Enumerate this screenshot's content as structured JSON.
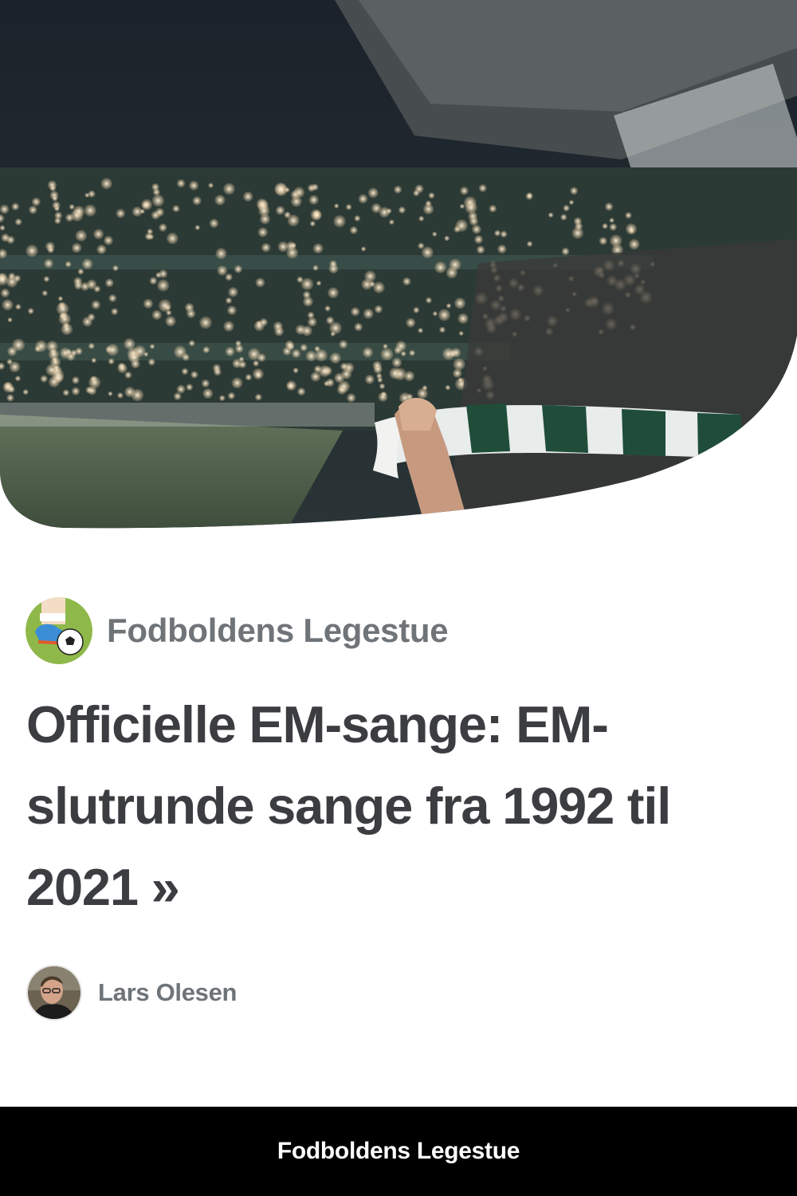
{
  "hero": {
    "image": "stadium-crowd-scarf-photo",
    "colors": {
      "sky": "#1e2630",
      "stands": "#2c3a36",
      "pitch": "#5a6b52",
      "scarf_green": "#1f4d3a",
      "scarf_white": "#e8ecea"
    }
  },
  "site": {
    "logo_icon": "soccer-boot-ball-icon",
    "name": "Fodboldens Legestue"
  },
  "article": {
    "title": "Officielle EM-sange: EM-slutrunde sange fra 1992 til 2021 »"
  },
  "author": {
    "avatar_icon": "author-portrait",
    "name": "Lars Olesen"
  },
  "footer": {
    "title": "Fodboldens Legestue"
  },
  "colors": {
    "heading": "#3b3d41",
    "meta": "#6f7479",
    "footer_bg": "#000000",
    "footer_text": "#ffffff",
    "logo_bg": "#8fb84a"
  }
}
